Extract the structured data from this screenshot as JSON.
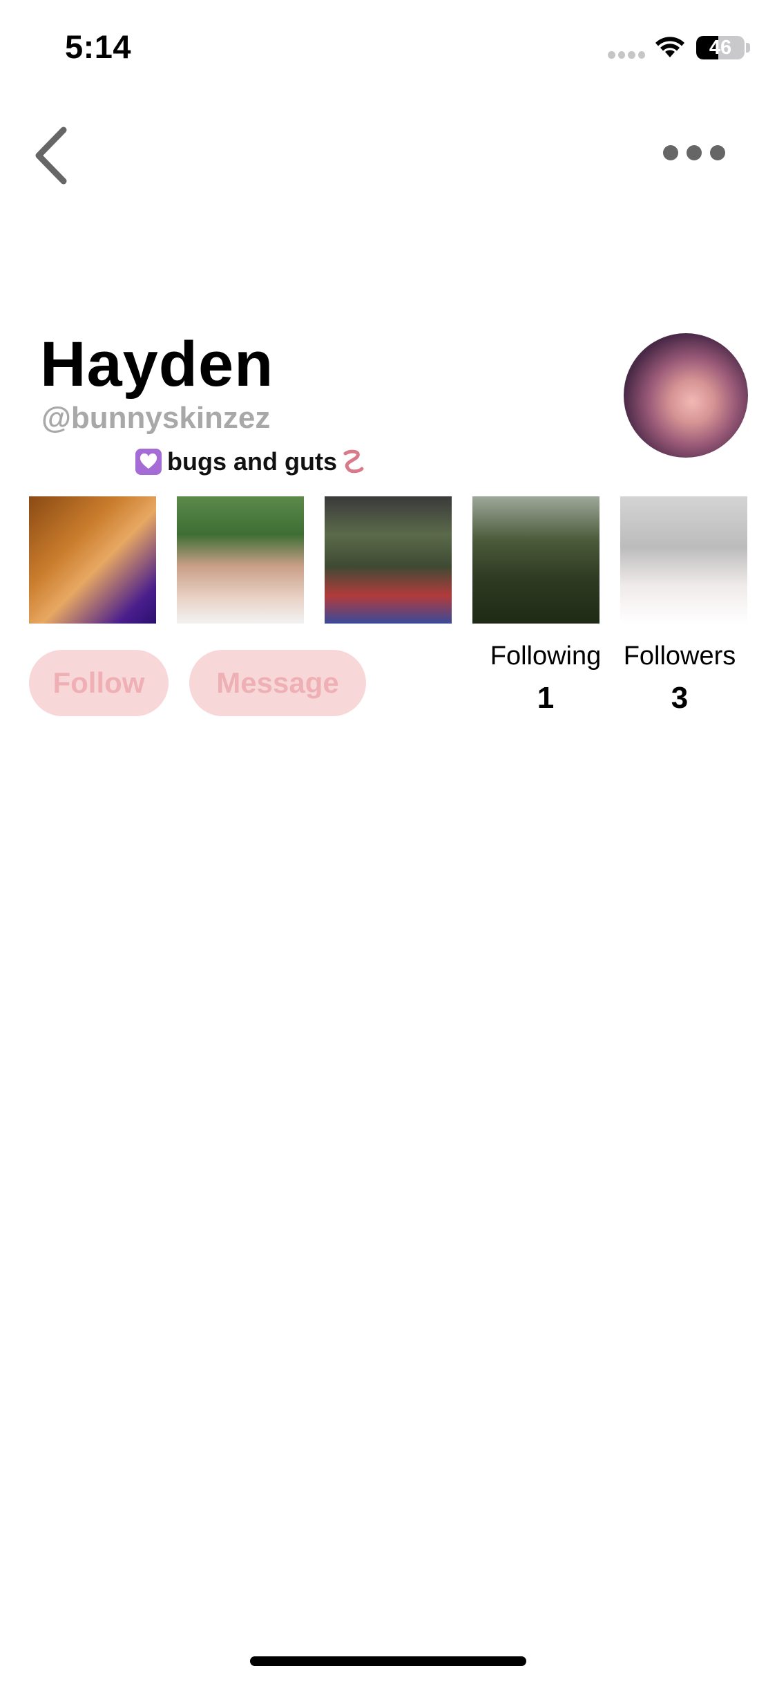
{
  "status_bar": {
    "time": "5:14",
    "battery_level": "46",
    "battery_fraction": 0.46,
    "icons": [
      "signal-dots-icon",
      "wifi-icon",
      "battery-icon"
    ]
  },
  "nav": {
    "back_icon": "chevron-left-icon",
    "more_icon": "more-horizontal-icon"
  },
  "profile": {
    "display_name": "Hayden",
    "username": "@bunnyskinzez",
    "bio_text": "bugs and guts",
    "bio_emoji_start": "heart-emoji",
    "bio_emoji_end": "worm-emoji",
    "avatar": "profile-photo"
  },
  "photos": [
    "photo-1",
    "photo-2",
    "photo-3",
    "photo-4",
    "photo-5"
  ],
  "actions": {
    "follow_label": "Follow",
    "message_label": "Message",
    "button_color": "#f8d7d9",
    "button_text_color": "#eeb0b4"
  },
  "stats": {
    "following_label": "Following",
    "following_value": "1",
    "followers_label": "Followers",
    "followers_value": "3"
  }
}
